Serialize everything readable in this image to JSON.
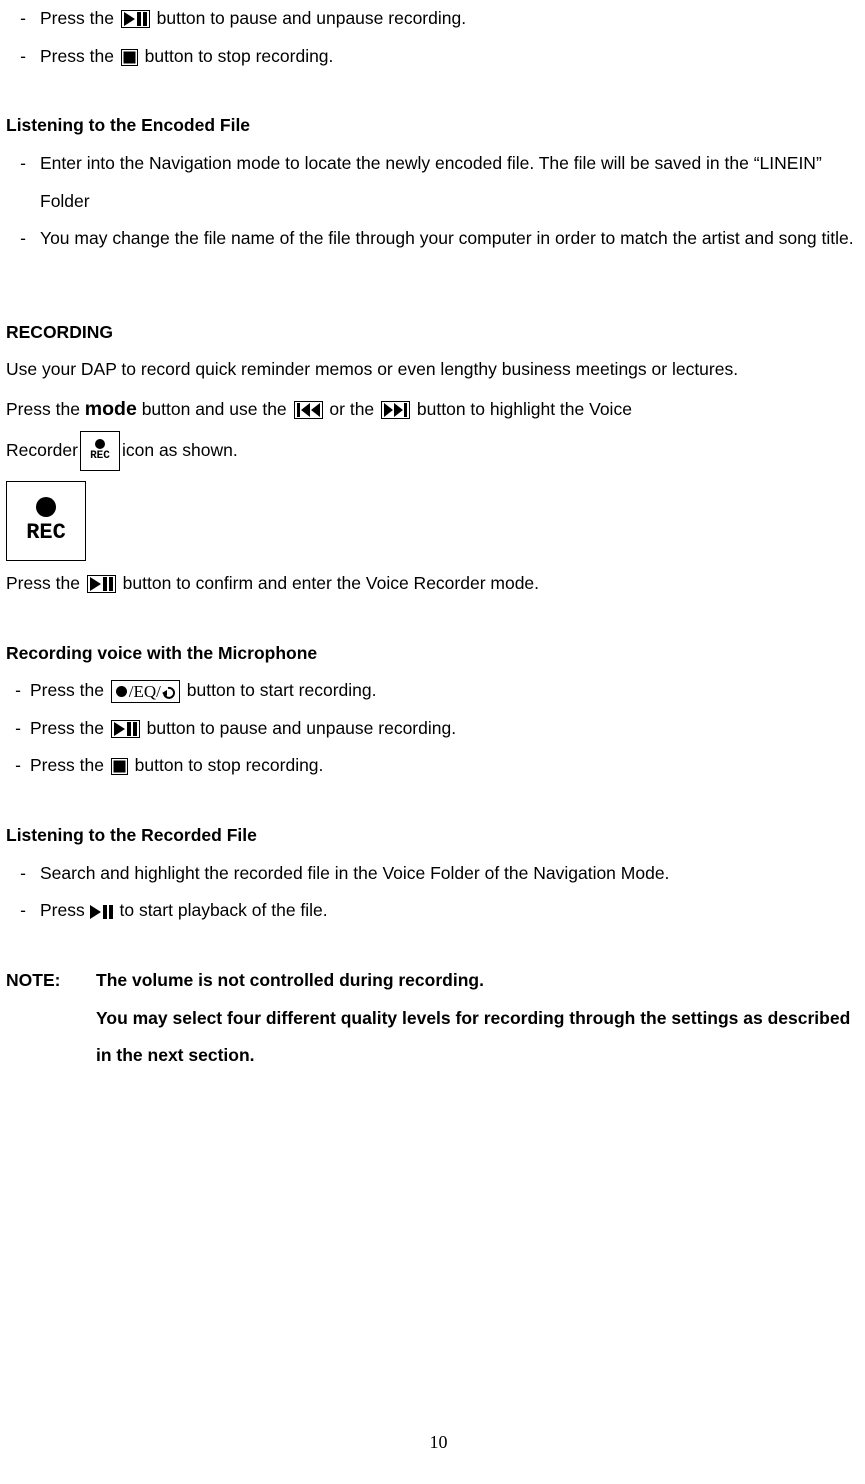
{
  "top_list": [
    {
      "pre": "Press the  ",
      "icon": "play-pause",
      "post": "  button to pause and unpause recording."
    },
    {
      "pre": "Press the  ",
      "icon": "stop",
      "post": "  button to stop recording."
    }
  ],
  "section_listening_encoded": {
    "heading": "Listening to the Encoded File",
    "items": [
      "Enter into the Navigation mode to locate the newly encoded file.    The file will be saved in the “LINEIN” Folder",
      "You may change the file name of the file through your computer in order to match the artist and song title."
    ]
  },
  "section_recording": {
    "heading": "RECORDING",
    "intro": "Use your DAP to record quick reminder memos or even lengthy business meetings or lectures.",
    "line2_a": "Press the  ",
    "mode_word": "mode",
    "line2_b": "  button and use the  ",
    "line2_c": "  or the  ",
    "line2_d": "  button to highlight the Voice",
    "line3_a": "Recorder ",
    "line3_b": "  icon as shown.",
    "confirm_a": "Press the   ",
    "confirm_b": "   button to confirm and enter the Voice Recorder mode."
  },
  "section_recording_mic": {
    "heading": "Recording voice with the Microphone",
    "items": [
      {
        "pre": "Press the  ",
        "icon": "eq-box",
        "post": "  button to start recording."
      },
      {
        "pre": "Press the   ",
        "icon": "play-pause",
        "post": "   button to pause and unpause recording."
      },
      {
        "pre": "Press the  ",
        "icon": "stop",
        "post": "   button to stop recording."
      }
    ]
  },
  "section_listening_recorded": {
    "heading": "Listening to the Recorded File",
    "items": [
      {
        "text": "Search and highlight the recorded file in the Voice Folder of the Navigation Mode."
      },
      {
        "pre": "Press ",
        "icon": "play-pause",
        "post": "  to start playback of the file."
      }
    ]
  },
  "note": {
    "label": "NOTE:",
    "line1": "The volume is not controlled during recording.",
    "line2": "You may select four different quality levels for recording through the settings as described in the next section."
  },
  "eq_label": "/EQ/",
  "rec_label": "REC",
  "page_number": "10"
}
